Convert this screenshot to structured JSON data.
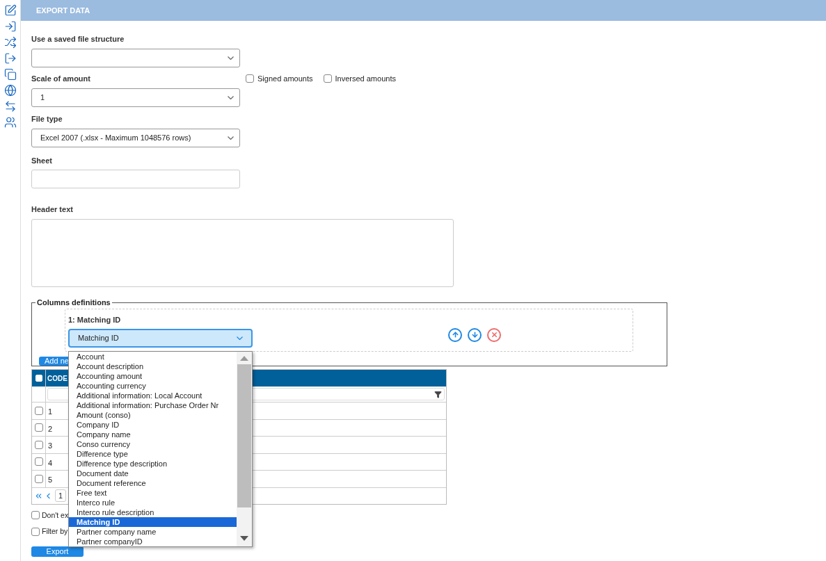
{
  "sidebar": {
    "icons": [
      {
        "kind": "grid-edit"
      },
      {
        "kind": "import"
      },
      {
        "kind": "shuffle"
      },
      {
        "kind": "export"
      },
      {
        "kind": "screens"
      },
      {
        "kind": "globe"
      },
      {
        "kind": "swap"
      },
      {
        "kind": "users"
      }
    ]
  },
  "header": {
    "title": "EXPORT DATA"
  },
  "form": {
    "saved_structure": {
      "label": "Use a saved file structure"
    },
    "scale": {
      "label": "Scale of amount",
      "value": "1"
    },
    "options": [
      {
        "label": "Signed amounts",
        "checked": false
      },
      {
        "label": "Inversed amounts",
        "checked": false
      }
    ],
    "file_type": {
      "label": "File type",
      "value": "Excel 2007 (.xlsx - Maximum 1048576 rows)"
    },
    "sheet": {
      "label": "Sheet"
    },
    "header_text": {
      "label": "Header text"
    }
  },
  "columns_definitions": {
    "legend": "Columns definitions",
    "column": {
      "title": "1: Matching ID",
      "value": "Matching ID"
    },
    "add_button": "Add ne"
  },
  "dropdown": {
    "items": [
      {
        "label": "Account",
        "selected": false
      },
      {
        "label": "Account description",
        "selected": false
      },
      {
        "label": "Accounting amount",
        "selected": false
      },
      {
        "label": "Accounting currency",
        "selected": false
      },
      {
        "label": "Additional information: Local Account",
        "selected": false
      },
      {
        "label": "Additional information: Purchase Order Nr",
        "selected": false
      },
      {
        "label": "Amount (conso)",
        "selected": false
      },
      {
        "label": "Company ID",
        "selected": false
      },
      {
        "label": "Company name",
        "selected": false
      },
      {
        "label": "Conso currency",
        "selected": false
      },
      {
        "label": "Difference type",
        "selected": false
      },
      {
        "label": "Difference type description",
        "selected": false
      },
      {
        "label": "Document date",
        "selected": false
      },
      {
        "label": "Document reference",
        "selected": false
      },
      {
        "label": "Free text",
        "selected": false
      },
      {
        "label": "Interco rule",
        "selected": false
      },
      {
        "label": "Interco rule description",
        "selected": false
      },
      {
        "label": "Matching ID",
        "selected": true
      },
      {
        "label": "Partner company name",
        "selected": false
      },
      {
        "label": "Partner companyID",
        "selected": false
      }
    ]
  },
  "table": {
    "all_checked": false,
    "columns": [
      "CODE"
    ],
    "rows": [
      {
        "code": "1",
        "checked": false
      },
      {
        "code": "2",
        "checked": false
      },
      {
        "code": "3",
        "checked": false
      },
      {
        "code": "4",
        "checked": false
      },
      {
        "code": "5",
        "checked": false
      }
    ],
    "page": "1"
  },
  "bottom_options": [
    {
      "label": "Don't ex",
      "checked": false
    },
    {
      "label": "Filter by",
      "checked": false
    }
  ],
  "export_button": "Export"
}
